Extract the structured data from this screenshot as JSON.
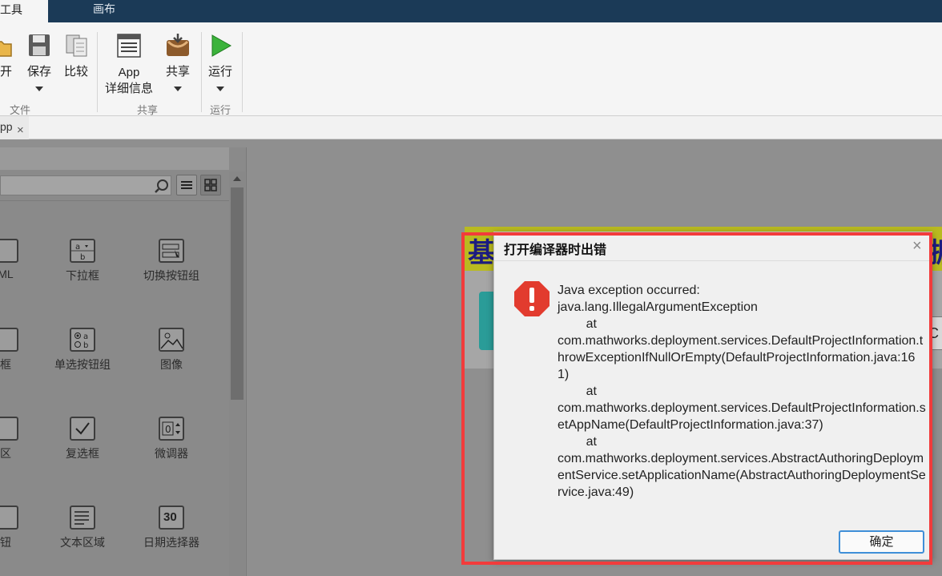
{
  "tabs": {
    "active": "工具",
    "inactive": "画布"
  },
  "ribbon": {
    "open_label": "开",
    "save_label": "保存",
    "compare_label": "比较",
    "app_details_line1": "App",
    "app_details_line2": "详细信息",
    "share_label": "共享",
    "run_label": "运行",
    "group_file": "文件",
    "group_share": "共享",
    "group_run": "运行"
  },
  "doc_tab": {
    "label": "pp",
    "close": "×"
  },
  "library": {
    "components": [
      {
        "label": "ML",
        "icon": "html-icon"
      },
      {
        "label": "下拉框",
        "icon": "dropdown-icon"
      },
      {
        "label": "切换按钮组",
        "icon": "toggle-button-group-icon"
      },
      {
        "label": "框",
        "icon": "listbox-icon"
      },
      {
        "label": "单选按钮组",
        "icon": "radio-button-group-icon"
      },
      {
        "label": "图像",
        "icon": "image-icon"
      },
      {
        "label": "区",
        "icon": "axes-icon"
      },
      {
        "label": "复选框",
        "icon": "checkbox-icon"
      },
      {
        "label": "微调器",
        "icon": "spinner-icon"
      },
      {
        "label": "钮",
        "icon": "button-icon"
      },
      {
        "label": "文本区域",
        "icon": "text-area-icon"
      },
      {
        "label": "日期选择器",
        "icon": "date-picker-icon"
      }
    ],
    "date_icon_text": "30"
  },
  "app_preview": {
    "banner_left": "基",
    "banner_right": "据",
    "right_field": "C"
  },
  "dialog": {
    "title": "打开编译器时出错",
    "close": "×",
    "message": "Java exception occurred:\njava.lang.IllegalArgumentException\n        at\ncom.mathworks.deployment.services.DefaultProjectInformation.throwExceptionIfNullOrEmpty(DefaultProjectInformation.java:161)\n        at\ncom.mathworks.deployment.services.DefaultProjectInformation.setAppName(DefaultProjectInformation.java:37)\n        at\ncom.mathworks.deployment.services.AbstractAuthoringDeploymentService.setApplicationName(AbstractAuthoringDeploymentService.java:49)",
    "ok_label": "确定"
  },
  "colors": {
    "accent_tabstrip": "#1b3a57",
    "error_red": "#e23b2e",
    "highlight_frame": "#f23b3b",
    "ok_border": "#3f8fd8"
  }
}
